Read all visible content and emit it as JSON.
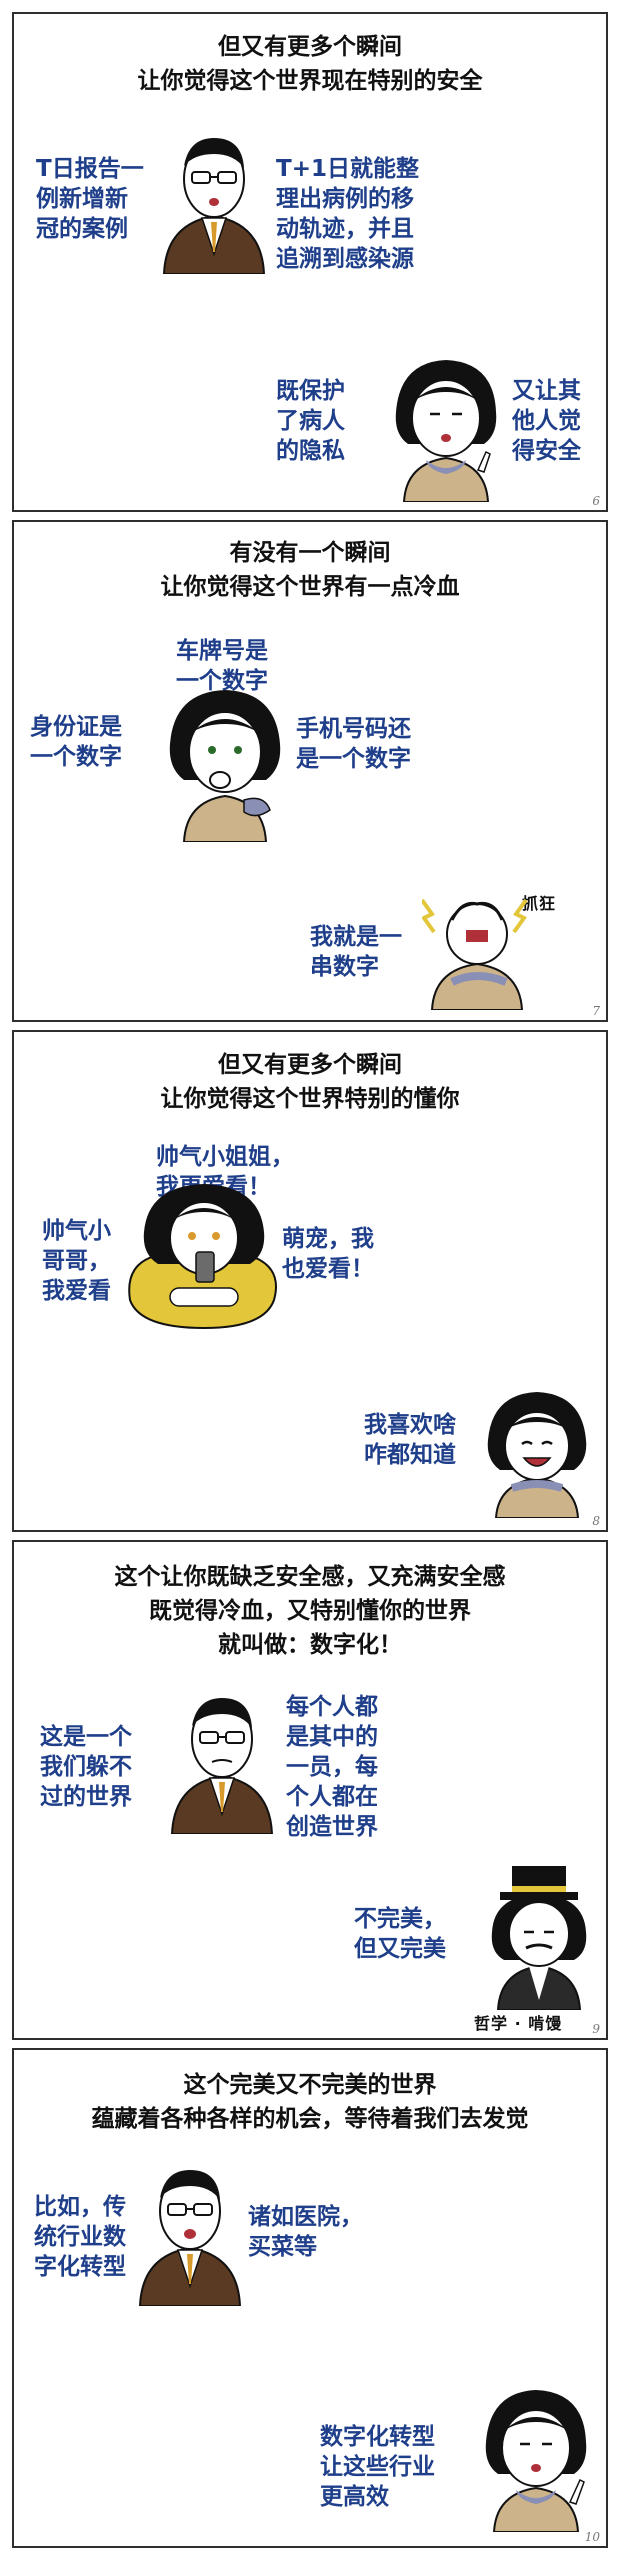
{
  "panels": [
    {
      "title": [
        "但又有更多个瞬间",
        "让你觉得这个世界现在特别的安全"
      ],
      "bubbles": {
        "a": "T日报告一\n例新增新\n冠的案例",
        "b": "T+1日就能整\n理出病例的移\n动轨迹，并且\n追溯到感染源",
        "c": "既保护\n了病人\n的隐私",
        "d": "又让其\n他人觉\n得安全"
      },
      "page": "6"
    },
    {
      "title": [
        "有没有一个瞬间",
        "让你觉得这个世界有一点冷血"
      ],
      "bubbles": {
        "a": "车牌号是\n一个数字",
        "b": "身份证是\n一个数字",
        "c": "手机号码还\n是一个数字",
        "d": "我就是一\n串数字",
        "e": "抓狂"
      },
      "page": "7"
    },
    {
      "title": [
        "但又有更多个瞬间",
        "让你觉得这个世界特别的懂你"
      ],
      "bubbles": {
        "a": "帅气小姐姐，\n我更爱看！",
        "b": "帅气小\n哥哥，\n我爱看",
        "c": "萌宠，我\n也爱看！",
        "d": "我喜欢啥\n咋都知道"
      },
      "page": "8"
    },
    {
      "title": [
        "这个让你既缺乏安全感，又充满安全感",
        "既觉得冷血，又特别懂你的世界",
        "就叫做：数字化！"
      ],
      "bubbles": {
        "a": "这是一个\n我们躲不\n过的世界",
        "b": "每个人都\n是其中的\n一员，每\n个人都在\n创造世界",
        "c": "不完美，\n但又完美",
        "d": "哲学 · 啃馒"
      },
      "page": "9"
    },
    {
      "title": [
        "这个完美又不完美的世界",
        "蕴藏着各种各样的机会，等待着我们去发觉"
      ],
      "bubbles": {
        "a": "比如，传\n统行业数\n字化转型",
        "b": "诸如医院，\n买菜等",
        "c": "数字化转型\n让这些行业\n更高效"
      },
      "page": "10"
    }
  ],
  "colors": {
    "text_blue": "#1f3f8b",
    "border": "#2f2f2f",
    "tan": "#cdb38a",
    "yellow": "#e3c63a",
    "suit": "#5a3a22"
  }
}
